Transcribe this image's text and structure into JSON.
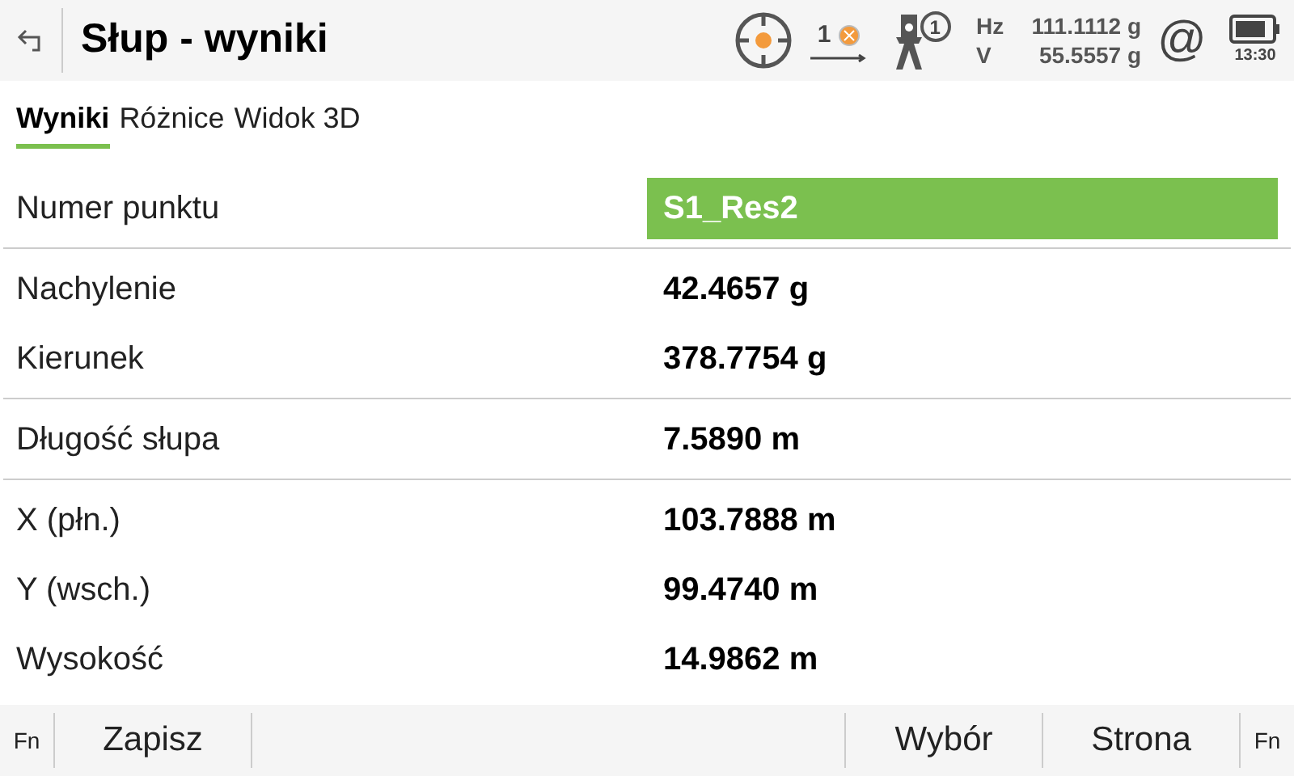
{
  "header": {
    "title": "Słup - wyniki",
    "target_count": "1",
    "instrument_badge": "1",
    "angles": [
      {
        "label": "Hz",
        "value": "111.1112 g"
      },
      {
        "label": "V",
        "value": "55.5557 g"
      }
    ],
    "connection_symbol": "@",
    "time": "13:30"
  },
  "tabs": [
    {
      "label": "Wyniki",
      "selected": true
    },
    {
      "label": "Różnice",
      "selected": false
    },
    {
      "label": "Widok 3D",
      "selected": false
    }
  ],
  "groups": [
    [
      {
        "label": "Numer punktu",
        "value": "S1_Res2",
        "highlighted": true
      }
    ],
    [
      {
        "label": "Nachylenie",
        "value": "42.4657 g",
        "highlighted": false
      },
      {
        "label": "Kierunek",
        "value": "378.7754 g",
        "highlighted": false
      }
    ],
    [
      {
        "label": "Długość słupa",
        "value": "7.5890 m",
        "highlighted": false
      }
    ],
    [
      {
        "label": "X (płn.)",
        "value": "103.7888 m",
        "highlighted": false
      },
      {
        "label": "Y (wsch.)",
        "value": "99.4740 m",
        "highlighted": false
      },
      {
        "label": "Wysokość",
        "value": "14.9862 m",
        "highlighted": false
      }
    ]
  ],
  "softkeys": {
    "fn_left": "Fn",
    "left": [
      "Zapisz"
    ],
    "right": [
      "Wybór",
      "Strona"
    ],
    "fn_right": "Fn"
  }
}
